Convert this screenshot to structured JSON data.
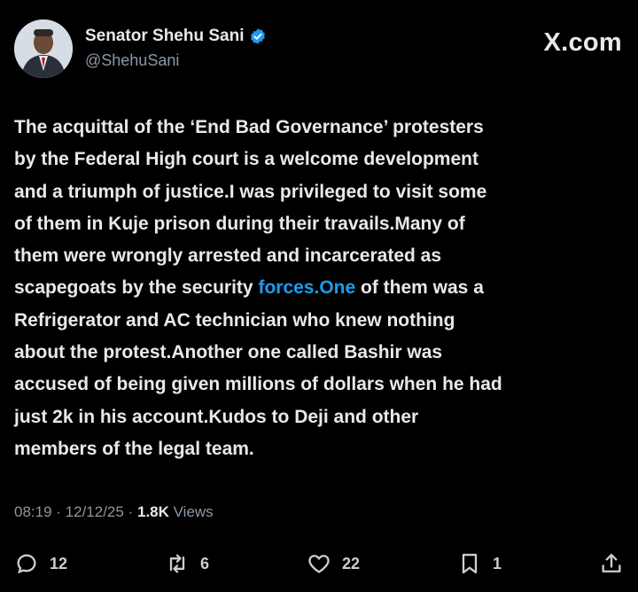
{
  "author": {
    "name": "Senator Shehu Sani",
    "handle": "@ShehuSani",
    "verified": true,
    "avatar_icon": "avatar-icon"
  },
  "brand": "X.com",
  "post": {
    "lines": [
      {
        "before": "The acquittal of the ‘End Bad Governance’ protesters"
      },
      {
        "before": "by the Federal High court is a welcome development"
      },
      {
        "before": "and a triumph of justice.I was privileged to visit some"
      },
      {
        "before": "of them in Kuje prison during their travails.Many of"
      },
      {
        "before": "them were wrongly arrested and incarcerated as"
      },
      {
        "before": "scapegoats by the security ",
        "link": "forces.One",
        "after": " of them was a"
      },
      {
        "before": "Refrigerator and AC technician who knew nothing"
      },
      {
        "before": "about the protest.Another one called Bashir was"
      },
      {
        "before": "accused of being given millions of dollars when he had"
      },
      {
        "before": "just 2k in his account.Kudos to Deji and other"
      },
      {
        "before": "members of the legal team."
      }
    ]
  },
  "meta": {
    "time": "08:19",
    "date": "12/12/25",
    "views_count": "1.8K",
    "views_label": "Views"
  },
  "actions": {
    "replies": "12",
    "reposts": "6",
    "likes": "22",
    "bookmarks": "1"
  },
  "colors": {
    "background": "#000000",
    "text": "#e7e9ea",
    "secondary": "#8b98a5",
    "link": "#1d9bf0"
  }
}
